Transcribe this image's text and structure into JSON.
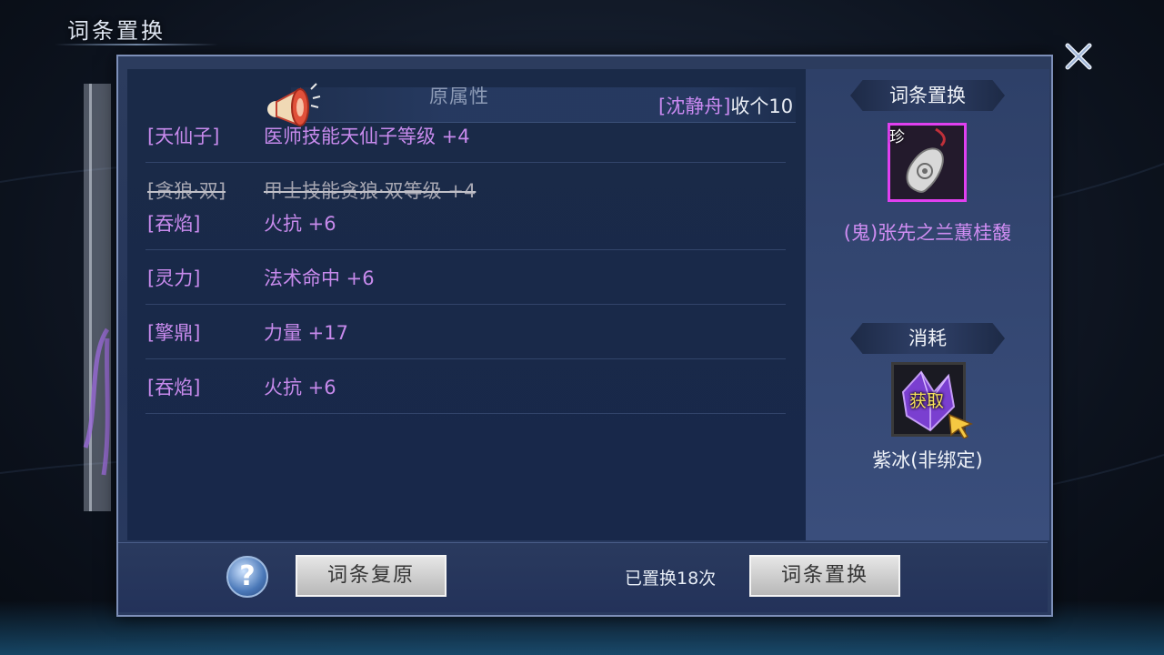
{
  "window": {
    "title": "词条置换"
  },
  "attributes_panel": {
    "column_header": "原属性",
    "marquee": {
      "name": "[沈静舟]",
      "message": "收个10"
    },
    "rows": [
      {
        "tag": "[天仙子]",
        "attr": "医师技能天仙子等级 +4",
        "struck": false
      },
      {
        "tag": "[贪狼·双]",
        "attr": "甲士技能贪狼·双等级 +4",
        "struck": true
      },
      {
        "tag": "[吞焰]",
        "attr": "火抗 +6",
        "struck": false
      },
      {
        "tag": "[灵力]",
        "attr": "法术命中 +6",
        "struck": false
      },
      {
        "tag": "[擎鼎]",
        "attr": "力量 +17",
        "struck": false
      },
      {
        "tag": "[吞焰]",
        "attr": "火抗 +6",
        "struck": false
      }
    ]
  },
  "target_item": {
    "section_label": "词条置换",
    "rarity_badge": "珍",
    "name": "(鬼)张先之兰蕙桂馥",
    "icon": "pendant-icon",
    "border_color": "#e040f0",
    "name_color": "#cf8df2"
  },
  "consume_item": {
    "section_label": "消耗",
    "overlay_label": "获取",
    "name": "紫冰(非绑定)",
    "icon": "purple-crystal-icon",
    "name_color": "#eef2f8"
  },
  "footer": {
    "restore_button": "词条复原",
    "replace_count": "已置换18次",
    "replace_button": "词条置换",
    "help_icon": "?"
  },
  "colors": {
    "accent_purple": "#c78aec",
    "struck_gray": "#a7a7b2",
    "panel_bg": "#2c3c5e"
  }
}
